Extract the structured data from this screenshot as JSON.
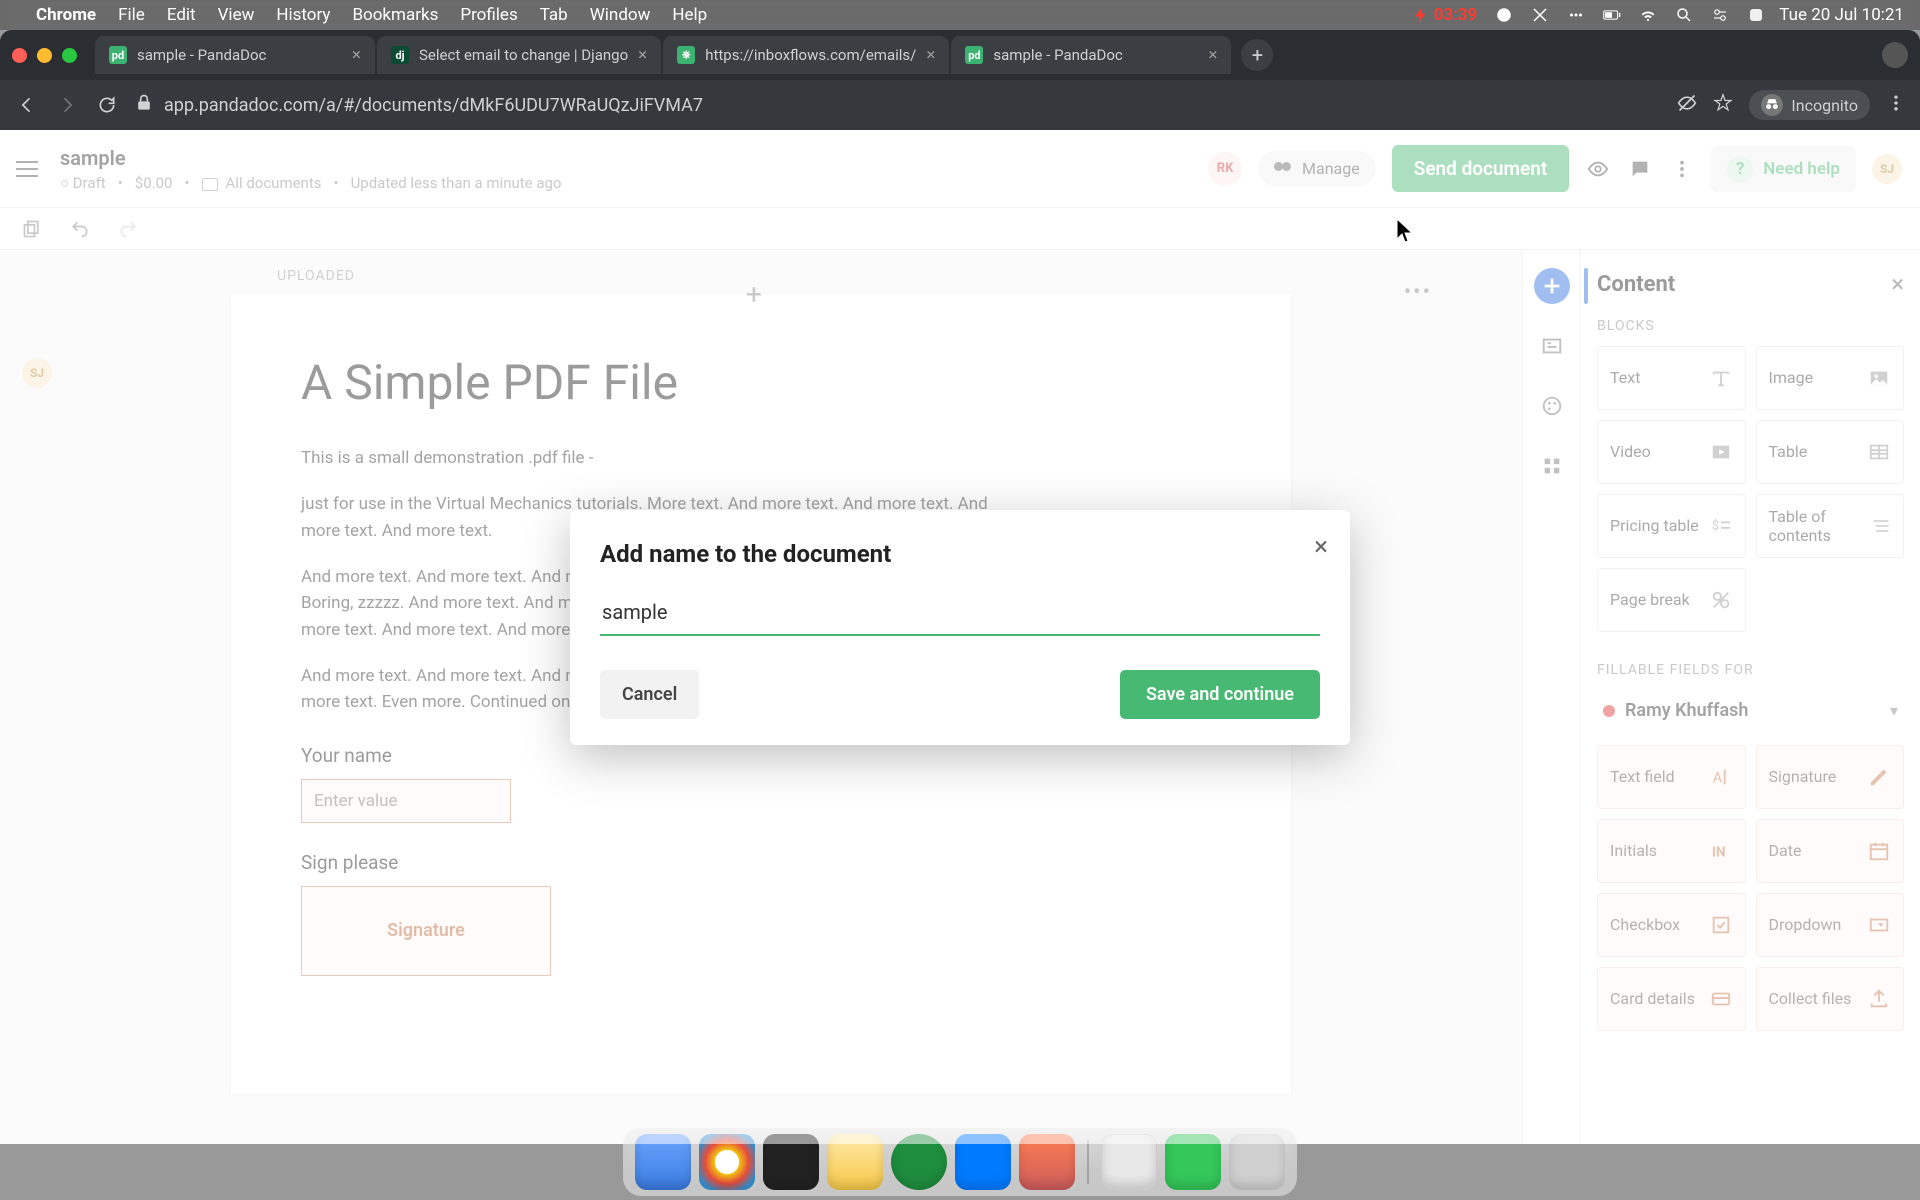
{
  "menubar": {
    "app_name": "Chrome",
    "items": [
      "File",
      "Edit",
      "View",
      "History",
      "Bookmarks",
      "Profiles",
      "Tab",
      "Window",
      "Help"
    ],
    "battery_time": "03:39",
    "clock": "Tue 20 Jul 10:21"
  },
  "browser": {
    "tabs": [
      {
        "title": "sample - PandaDoc",
        "favicon": "pd",
        "active": false
      },
      {
        "title": "Select email to change | Django",
        "favicon": "dj",
        "active": false
      },
      {
        "title": "https://inboxflows.com/emails/",
        "favicon": "pd",
        "active": false
      },
      {
        "title": "sample - PandaDoc",
        "favicon": "pd",
        "active": true
      }
    ],
    "url": "app.pandadoc.com/a/#/documents/dMkF6UDU7WRaUQzJiFVMA7",
    "profile": "Incognito"
  },
  "header": {
    "doc_title": "sample",
    "status": "Draft",
    "price": "$0.00",
    "folder": "All documents",
    "updated": "Updated less than a minute ago",
    "rk_badge": "RK",
    "manage_label": "Manage",
    "send_label": "Send document",
    "need_help": "Need help",
    "sj_badge": "SJ"
  },
  "canvas": {
    "section_label": "UPLOADED",
    "left_badge": "SJ",
    "h1": "A Simple PDF File",
    "p1": "This is a small demonstration .pdf file -",
    "p2": "just for use in the Virtual Mechanics tutorials. More text. And more text. And more text. And more text. And more text.",
    "p3": "And more text. And more text. And more text. And more text. And more text. And more text. Boring, zzzzz. And more text. And more text. And more text. And more text. And more text. And more text. And more text. And more text. And more text.",
    "p4": "And more text. And more text. And more text. And more text. And more text. And more text. And more text. Even more. Continued on page 2 ...",
    "name_label": "Your name",
    "name_placeholder": "Enter value",
    "sign_label": "Sign please",
    "sign_box": "Signature"
  },
  "panel": {
    "title": "Content",
    "blocks_label": "BLOCKS",
    "blocks": [
      "Text",
      "Image",
      "Video",
      "Table",
      "Pricing table",
      "Table of contents",
      "Page break"
    ],
    "fields_label": "FILLABLE FIELDS FOR",
    "recipient": "Ramy Khuffash",
    "fields": [
      "Text field",
      "Signature",
      "Initials",
      "Date",
      "Checkbox",
      "Dropdown",
      "Card details",
      "Collect files"
    ]
  },
  "modal": {
    "title": "Add name to the document",
    "value": "sample",
    "cancel": "Cancel",
    "save": "Save and continue"
  }
}
